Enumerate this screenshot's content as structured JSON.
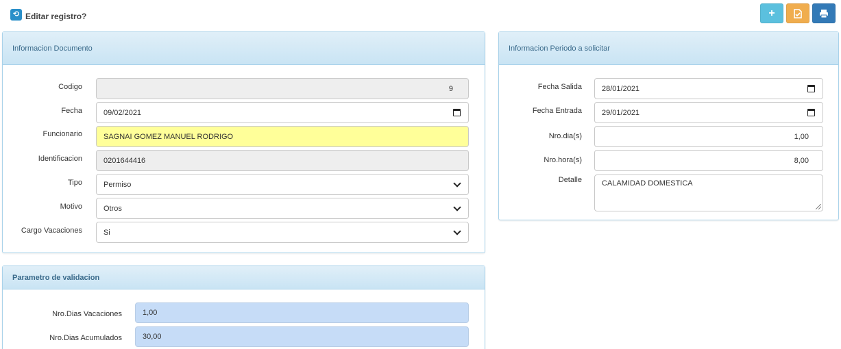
{
  "header": {
    "title": "Editar registro?",
    "icon": "refresh-icon"
  },
  "toolbar": {
    "buttons": [
      {
        "name": "add",
        "icon": "plus-icon",
        "color": "#5bc0de"
      },
      {
        "name": "save",
        "icon": "save-document-icon",
        "color": "#f0ad4e"
      },
      {
        "name": "print",
        "icon": "print-icon",
        "color": "#337ab7"
      }
    ]
  },
  "documento": {
    "title": "Informacion Documento",
    "codigo_label": "Codigo",
    "codigo_value": "9",
    "fecha_label": "Fecha",
    "fecha_value": "09/02/2021",
    "funcionario_label": "Funcionario",
    "funcionario_value": "SAGNAI GOMEZ MANUEL RODRIGO",
    "identificacion_label": "Identificacion",
    "identificacion_value": "0201644416",
    "tipo_label": "Tipo",
    "tipo_value": "Permiso",
    "motivo_label": "Motivo",
    "motivo_value": "Otros",
    "cargo_label": "Cargo Vacaciones",
    "cargo_value": "Si"
  },
  "periodo": {
    "title": "Informacion Periodo a solicitar",
    "salida_label": "Fecha Salida",
    "salida_value": "28/01/2021",
    "entrada_label": "Fecha Entrada",
    "entrada_value": "29/01/2021",
    "dias_label": "Nro.dia(s)",
    "dias_value": "1,00",
    "horas_label": "Nro.hora(s)",
    "horas_value": "8,00",
    "detalle_label": "Detalle",
    "detalle_value": "CALAMIDAD DOMESTICA"
  },
  "validacion": {
    "title": "Parametro de validacion",
    "vacaciones_label": "Nro.Dias Vacaciones",
    "vacaciones_value": "1,00",
    "acumulados_label": "Nro.Dias Acumulados",
    "acumulados_value": "30,00"
  }
}
